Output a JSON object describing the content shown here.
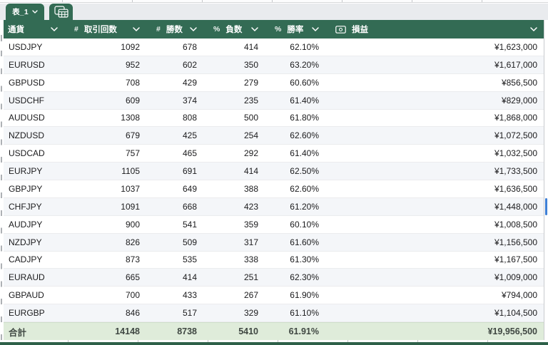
{
  "tab_bar": {
    "tabs": [
      {
        "label": "表_1",
        "active": true,
        "chevron_icon": "chevron-down-icon"
      }
    ],
    "table_icon_tab": {
      "icon": "table-grid-icon"
    }
  },
  "table": {
    "columns": [
      {
        "label": "通貨",
        "type_icon": "",
        "sort_icon": "chevron-down-icon"
      },
      {
        "label": "取引回数",
        "type_icon": "#",
        "sort_icon": "chevron-down-icon"
      },
      {
        "label": "勝数",
        "type_icon": "#",
        "sort_icon": "chevron-down-icon"
      },
      {
        "label": "負数",
        "type_icon": "%",
        "sort_icon": "chevron-down-icon"
      },
      {
        "label": "勝率",
        "type_icon": "%",
        "sort_icon": "chevron-down-icon"
      },
      {
        "label": "損益",
        "type_icon_name": "banknote-icon",
        "sort_icon": "chevron-down-icon"
      }
    ],
    "rows": [
      {
        "pair": "USDJPY",
        "trades": "1092",
        "wins": "678",
        "losses": "414",
        "win_rate": "62.10%",
        "pnl": "¥1,623,000"
      },
      {
        "pair": "EURUSD",
        "trades": "952",
        "wins": "602",
        "losses": "350",
        "win_rate": "63.20%",
        "pnl": "¥1,617,000"
      },
      {
        "pair": "GBPUSD",
        "trades": "708",
        "wins": "429",
        "losses": "279",
        "win_rate": "60.60%",
        "pnl": "¥856,500"
      },
      {
        "pair": "USDCHF",
        "trades": "609",
        "wins": "374",
        "losses": "235",
        "win_rate": "61.40%",
        "pnl": "¥829,000"
      },
      {
        "pair": "AUDUSD",
        "trades": "1308",
        "wins": "808",
        "losses": "500",
        "win_rate": "61.80%",
        "pnl": "¥1,868,000"
      },
      {
        "pair": "NZDUSD",
        "trades": "679",
        "wins": "425",
        "losses": "254",
        "win_rate": "62.60%",
        "pnl": "¥1,072,500"
      },
      {
        "pair": "USDCAD",
        "trades": "757",
        "wins": "465",
        "losses": "292",
        "win_rate": "61.40%",
        "pnl": "¥1,032,500"
      },
      {
        "pair": "EURJPY",
        "trades": "1105",
        "wins": "691",
        "losses": "414",
        "win_rate": "62.50%",
        "pnl": "¥1,733,500"
      },
      {
        "pair": "GBPJPY",
        "trades": "1037",
        "wins": "649",
        "losses": "388",
        "win_rate": "62.60%",
        "pnl": "¥1,636,500"
      },
      {
        "pair": "CHFJPY",
        "trades": "1091",
        "wins": "668",
        "losses": "423",
        "win_rate": "61.20%",
        "pnl": "¥1,448,000"
      },
      {
        "pair": "AUDJPY",
        "trades": "900",
        "wins": "541",
        "losses": "359",
        "win_rate": "60.10%",
        "pnl": "¥1,008,500"
      },
      {
        "pair": "NZDJPY",
        "trades": "826",
        "wins": "509",
        "losses": "317",
        "win_rate": "61.60%",
        "pnl": "¥1,156,500"
      },
      {
        "pair": "CADJPY",
        "trades": "873",
        "wins": "535",
        "losses": "338",
        "win_rate": "61.30%",
        "pnl": "¥1,167,500"
      },
      {
        "pair": "EURAUD",
        "trades": "665",
        "wins": "414",
        "losses": "251",
        "win_rate": "62.30%",
        "pnl": "¥1,009,000"
      },
      {
        "pair": "GBPAUD",
        "trades": "700",
        "wins": "433",
        "losses": "267",
        "win_rate": "61.90%",
        "pnl": "¥794,000"
      },
      {
        "pair": "EURGBP",
        "trades": "846",
        "wins": "517",
        "losses": "329",
        "win_rate": "61.10%",
        "pnl": "¥1,104,500"
      }
    ],
    "total": {
      "label": "合計",
      "trades": "14148",
      "wins": "8738",
      "losses": "5410",
      "win_rate": "61.91%",
      "pnl": "¥19,956,500"
    }
  },
  "colors": {
    "header_green": "#336b54",
    "footer_green": "#2d6048",
    "total_row_bg": "#dfecda",
    "alt_row_bg": "#f4f6f9",
    "tab_bar_bg": "#e9ebee",
    "scroll_accent": "#3d7fd6",
    "data_text": "#1b1b1d",
    "total_text": "#3f4742"
  }
}
